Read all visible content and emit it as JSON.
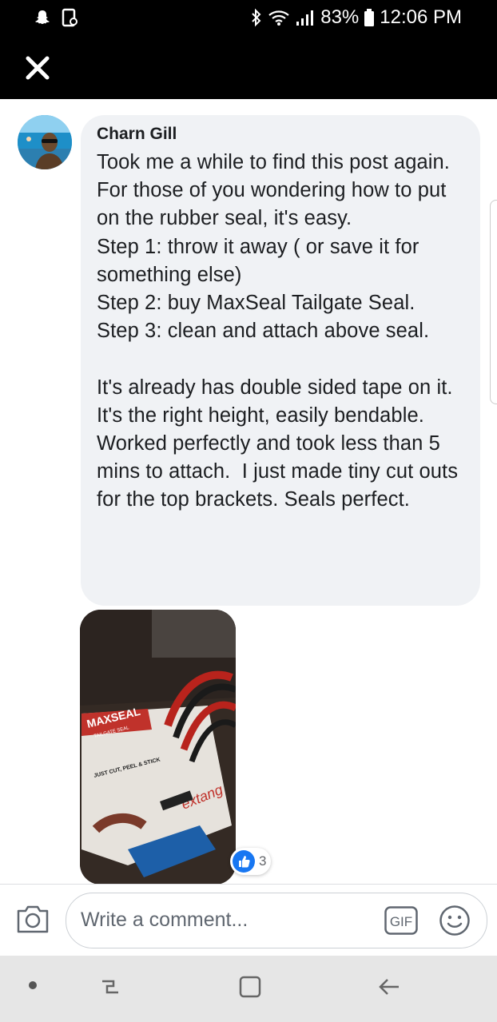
{
  "status_bar": {
    "battery": "83%",
    "time": "12:06 PM",
    "icons": [
      "snapchat-icon",
      "screenshot-icon",
      "bluetooth-icon",
      "wifi-icon",
      "signal-icon",
      "battery-icon"
    ]
  },
  "header": {
    "close_icon": "close-icon"
  },
  "comment": {
    "author": "Charn Gill",
    "text": "Took me a while to find this post again.  For those of you wondering how to put on the rubber seal, it's easy.\nStep 1: throw it away ( or save it for something else)\nStep 2: buy MaxSeal Tailgate Seal.\nStep 3: clean and attach above seal.\n\nIt's already has double sided tape on it. It's the right height, easily bendable.\nWorked perfectly and took less than 5 mins to attach.  I just made tiny cut outs for the top brackets. Seals perfect.",
    "reaction_count": "3",
    "photo": {
      "brand": "MAXSEAL",
      "product": "TAILGATE SEAL",
      "tagline": "JUST CUT, PEEL & STICK",
      "maker": "extang"
    }
  },
  "composer": {
    "placeholder": "Write a comment...",
    "gif_label": "GIF"
  },
  "colors": {
    "header_bg": "#000000",
    "bubble_bg": "#f0f2f5",
    "like_blue": "#1877f2"
  }
}
